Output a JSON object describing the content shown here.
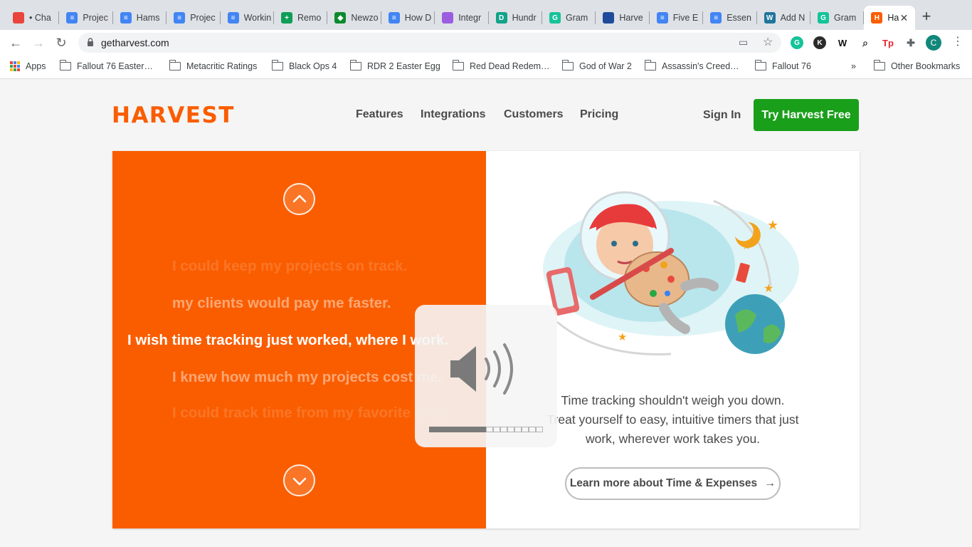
{
  "browser": {
    "tabs": [
      {
        "label": "• Cha",
        "fav_color": "#e8453c",
        "fav_glyph": "",
        "icon": "asana-icon"
      },
      {
        "label": "Projec",
        "fav_color": "#4285f4",
        "fav_glyph": "≡",
        "icon": "docs-icon"
      },
      {
        "label": "Hams",
        "fav_color": "#4285f4",
        "fav_glyph": "≡",
        "icon": "docs-icon"
      },
      {
        "label": "Projec",
        "fav_color": "#4285f4",
        "fav_glyph": "≡",
        "icon": "docs-icon"
      },
      {
        "label": "Workin",
        "fav_color": "#4285f4",
        "fav_glyph": "≡",
        "icon": "docs-icon"
      },
      {
        "label": "Remo",
        "fav_color": "#0f9d58",
        "fav_glyph": "+",
        "icon": "sheets-icon"
      },
      {
        "label": "Newzo",
        "fav_color": "#0b8a2e",
        "fav_glyph": "◆",
        "icon": "newzoo-icon"
      },
      {
        "label": "How D",
        "fav_color": "#4285f4",
        "fav_glyph": "≡",
        "icon": "docs-icon"
      },
      {
        "label": "Integr",
        "fav_color": "#9c5de0",
        "fav_glyph": "",
        "icon": "integrations-icon"
      },
      {
        "label": "Hundr",
        "fav_color": "#12a389",
        "fav_glyph": "D",
        "icon": "d-icon"
      },
      {
        "label": "Gram",
        "fav_color": "#15c39a",
        "fav_glyph": "G",
        "icon": "grammarly-icon"
      },
      {
        "label": "Harve",
        "fav_color": "#1f4b9a",
        "fav_glyph": "",
        "icon": "harvest-alt-icon"
      },
      {
        "label": "Five E",
        "fav_color": "#4285f4",
        "fav_glyph": "≡",
        "icon": "docs-icon"
      },
      {
        "label": "Essen",
        "fav_color": "#4285f4",
        "fav_glyph": "≡",
        "icon": "docs-icon"
      },
      {
        "label": "Add N",
        "fav_color": "#21759b",
        "fav_glyph": "W",
        "icon": "wordpress-icon"
      },
      {
        "label": "Gram",
        "fav_color": "#15c39a",
        "fav_glyph": "G",
        "icon": "grammarly-icon"
      },
      {
        "label": "Ha",
        "fav_color": "#fa5d00",
        "fav_glyph": "H",
        "icon": "harvest-icon"
      }
    ],
    "url": "getharvest.com",
    "bookmarks": [
      "Apps",
      "Fallout 76 Easter…",
      "Metacritic Ratings",
      "Black Ops 4",
      "RDR 2 Easter Egg",
      "Red Dead Redem…",
      "God of War 2",
      "Assassin's Creed…",
      "Fallout 76"
    ],
    "more_bookmarks": "»",
    "other_bookmarks": "Other Bookmarks",
    "profile_initial": "C"
  },
  "site": {
    "logo": "HARVEST",
    "nav": [
      "Features",
      "Integrations",
      "Customers",
      "Pricing"
    ],
    "sign_in": "Sign In",
    "cta": "Try Harvest Free",
    "colors": {
      "brand": "#fa5d00",
      "cta": "#1a9f1a"
    }
  },
  "hero": {
    "phrases": [
      "I could keep my projects on track.",
      "my clients would pay me faster.",
      "I wish time tracking just worked, where I work.",
      "I knew how much my projects cost me.",
      "I could track time from my favorite tools."
    ],
    "description_lines": [
      "Time tracking shouldn't weigh you down.",
      "Treat yourself to easy, intuitive timers that just",
      "work, wherever work takes you."
    ],
    "learn_more": "Learn more about Time & Expenses",
    "learn_more_arrow": "→"
  },
  "volume_overlay": {
    "level_fraction": 0.5,
    "icon": "speaker-volume-icon"
  }
}
